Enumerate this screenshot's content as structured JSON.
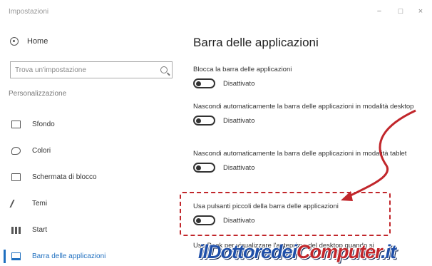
{
  "window": {
    "title": "Impostazioni",
    "controls": {
      "minimize": "−",
      "maximize": "□",
      "close": "×"
    }
  },
  "sidebar": {
    "home_label": "Home",
    "search_placeholder": "Trova un'impostazione",
    "section_label": "Personalizzazione",
    "items": [
      {
        "label": "Sfondo",
        "icon": "monitor-icon"
      },
      {
        "label": "Colori",
        "icon": "palette-icon"
      },
      {
        "label": "Schermata di blocco",
        "icon": "lockscreen-icon"
      },
      {
        "label": "Temi",
        "icon": "brush-icon"
      },
      {
        "label": "Start",
        "icon": "start-icon"
      },
      {
        "label": "Barra delle applicazioni",
        "icon": "taskbar-icon",
        "active": true
      }
    ]
  },
  "main": {
    "title": "Barra delle applicazioni",
    "settings": [
      {
        "label": "Blocca la barra delle applicazioni",
        "state": "Disattivato"
      },
      {
        "label": "Nascondi automaticamente la barra delle applicazioni in modalità desktop",
        "state": "Disattivato"
      },
      {
        "label": "Nascondi automaticamente la barra delle applicazioni in modalità tablet",
        "state": "Disattivato"
      },
      {
        "label": "Usa pulsanti piccoli della barra delle applicazioni",
        "state": "Disattivato",
        "highlighted": true
      },
      {
        "label": "Usa Peek per visualizzare l'anteprima del desktop quando si"
      }
    ]
  },
  "watermark": {
    "part1": "ilDottoredei",
    "part2": "Computer",
    "part3": ".it"
  },
  "colors": {
    "accent": "#1f6fbf",
    "annotation": "#c1262b",
    "watermark": "#1f4fa8"
  }
}
